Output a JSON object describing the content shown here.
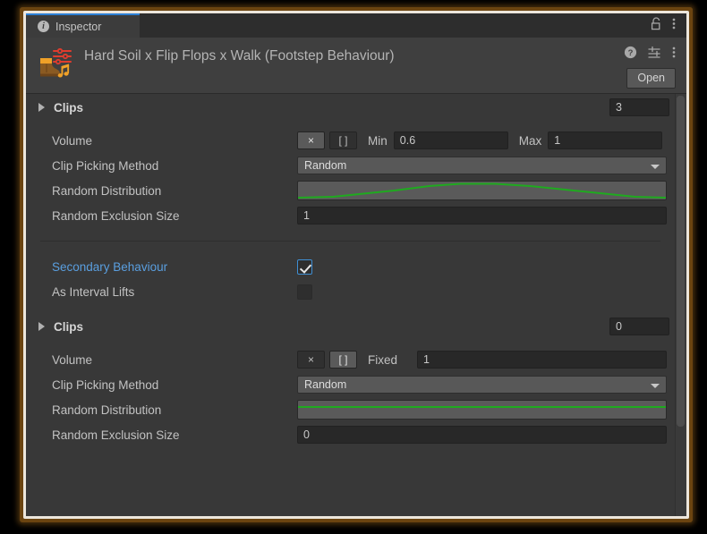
{
  "window": {
    "tab_label": "Inspector",
    "tab_icon": "info-icon",
    "lock_icon": "lock-open-icon",
    "tab_menu_icon": "kebab-menu-icon"
  },
  "object_header": {
    "title": "Hard Soil x Flip Flops x Walk (Footstep Behaviour)",
    "thumbnail_icon": "footstep-behaviour-icon",
    "help_icon": "help-icon",
    "preset_icon": "preset-select-icon",
    "menu_icon": "kebab-menu-icon",
    "open_button": "Open"
  },
  "accent_colors": {
    "tab_accent": "#2c7fd4",
    "link_text": "#5a9fe0",
    "curve_line": "#1faa1f",
    "checkbox_checked_border": "#3f8fd4",
    "frame_outer": "#6b4410",
    "frame_inner": "#ece6dc"
  },
  "sections": [
    {
      "foldout": {
        "label": "Clips",
        "count": "3",
        "expanded": false
      },
      "volume": {
        "label": "Volume",
        "buttons": [
          {
            "label": "×",
            "name": "volume-random-range-button",
            "active": true
          },
          {
            "label": "[ ]",
            "name": "volume-fixed-button",
            "active": false
          }
        ],
        "fields": [
          {
            "label": "Min",
            "value": "0.6"
          },
          {
            "label": "Max",
            "value": "1"
          }
        ]
      },
      "clip_picking": {
        "label": "Clip Picking Method",
        "value": "Random"
      },
      "random_distribution": {
        "label": "Random Distribution",
        "curve": "bell"
      },
      "random_exclusion": {
        "label": "Random Exclusion Size",
        "value": "1"
      }
    },
    {
      "secondary": {
        "label": "Secondary Behaviour",
        "checked": true
      },
      "as_interval_lifts": {
        "label": "As Interval Lifts",
        "checked": false
      },
      "foldout": {
        "label": "Clips",
        "count": "0",
        "expanded": false
      },
      "volume": {
        "label": "Volume",
        "buttons": [
          {
            "label": "×",
            "name": "volume-random-range-button",
            "active": false
          },
          {
            "label": "[ ]",
            "name": "volume-fixed-button",
            "active": true
          }
        ],
        "fields": [
          {
            "label": "Fixed",
            "value": "1"
          }
        ]
      },
      "clip_picking": {
        "label": "Clip Picking Method",
        "value": "Random"
      },
      "random_distribution": {
        "label": "Random Distribution",
        "curve": "flat"
      },
      "random_exclusion": {
        "label": "Random Exclusion Size",
        "value": "0"
      }
    }
  ]
}
